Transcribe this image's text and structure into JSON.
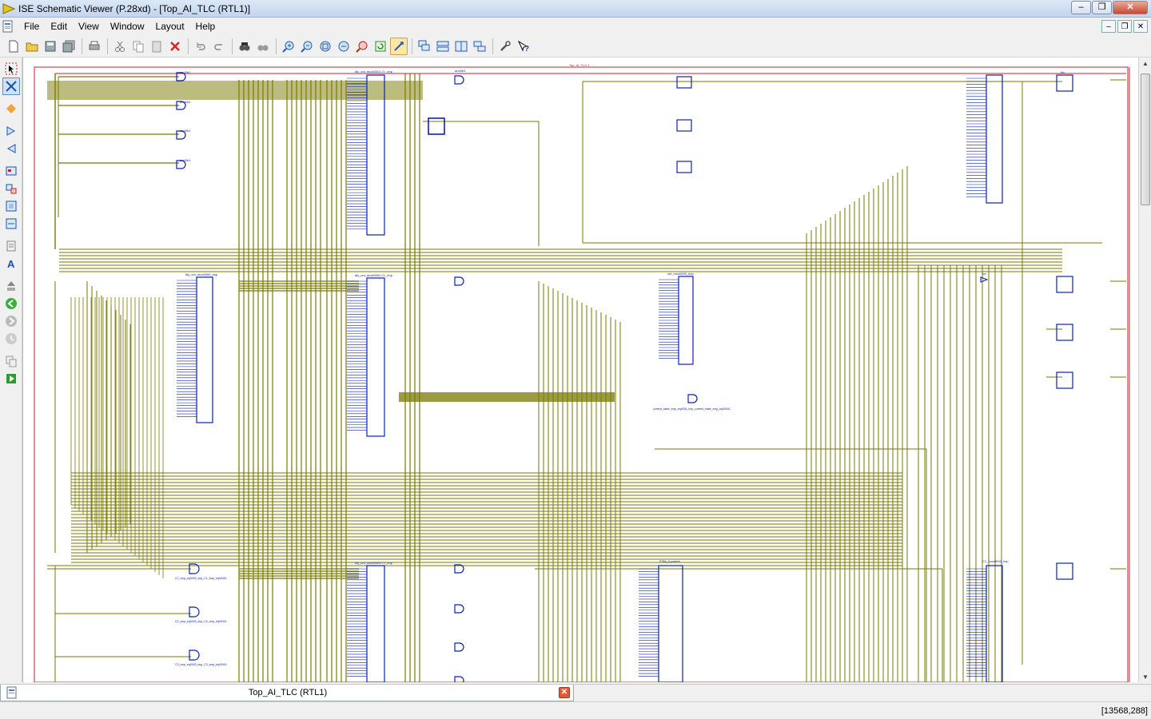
{
  "window": {
    "title": "ISE Schematic Viewer (P.28xd) - [Top_AI_TLC (RTL1)]",
    "controls": {
      "minimize": "–",
      "restore": "❐",
      "close": "✕"
    }
  },
  "menu": {
    "items": [
      "File",
      "Edit",
      "View",
      "Window",
      "Layout",
      "Help"
    ],
    "mdi_controls": {
      "minimize": "–",
      "restore": "❐",
      "close": "✕"
    }
  },
  "toolbar": {
    "icons": [
      "new-icon",
      "open-icon",
      "save-icon",
      "save-all-icon",
      "print-icon",
      "cut-icon",
      "copy-icon",
      "paste-icon",
      "delete-icon",
      "undo-icon",
      "redo-icon",
      "find-icon",
      "find-next-icon",
      "zoom-in-icon",
      "zoom-out-icon",
      "zoom-full-icon",
      "zoom-fit-icon",
      "zoom-area-icon",
      "refresh-icon",
      "pan-icon",
      "cascade-icon",
      "tile-horizontal-icon",
      "tile-vertical-icon",
      "arrange-icon",
      "properties-icon",
      "whats-this-icon"
    ]
  },
  "left_tools": {
    "icons": [
      "select-icon",
      "route-icon",
      "highlight-icon",
      "add-pin-icon",
      "remove-pin-icon",
      "expand-icon",
      "collapse-icon",
      "block-icon",
      "net-icon",
      "symbol-icon",
      "text-icon",
      "push-icon",
      "back-icon",
      "forward-icon",
      "history-icon",
      "copy-view-icon",
      "run-icon"
    ]
  },
  "schematic": {
    "wire_color": "#7a7a00",
    "symbol_color": "#0b22b3",
    "border_color": "#c0202f",
    "labels": {
      "top_module": "Top_AI_TLC:1",
      "gate_and1": "and2b1",
      "gate_and2": "and2b1",
      "gate_and3": "and2b1",
      "gate_and4": "and2b1",
      "mux1": "dly_cnt_mux0001<7>_imp",
      "mux2": "dly_cnt_mux0002<7>_imp",
      "mux3": "dly_cnt_mux0003<7>_imp",
      "mux4": "dly_cnt_mux0000_imp",
      "fsm": "FSM_0-parent",
      "reg1": "cnt_mux0000_imp",
      "reg2": "C1_mux0000_imp",
      "fdc_label": "fdc",
      "inv_label": "inv",
      "and_current_state": "current_state_cmp_eq0004_imp_current_state_cmp_eq00041",
      "and3_label": "and3b3",
      "bottom_gates": [
        "C1_cmp_eq0000_imp_C1_cmp_eq00001",
        "C2_cmp_eq0000_imp_C2_cmp_eq00001",
        "C3_cmp_eq0000_imp_C3_cmp_eq00001"
      ]
    }
  },
  "tabs": {
    "active": "Top_AI_TLC (RTL1)",
    "close": "✕"
  },
  "status": {
    "coords": "[13568,288]"
  }
}
